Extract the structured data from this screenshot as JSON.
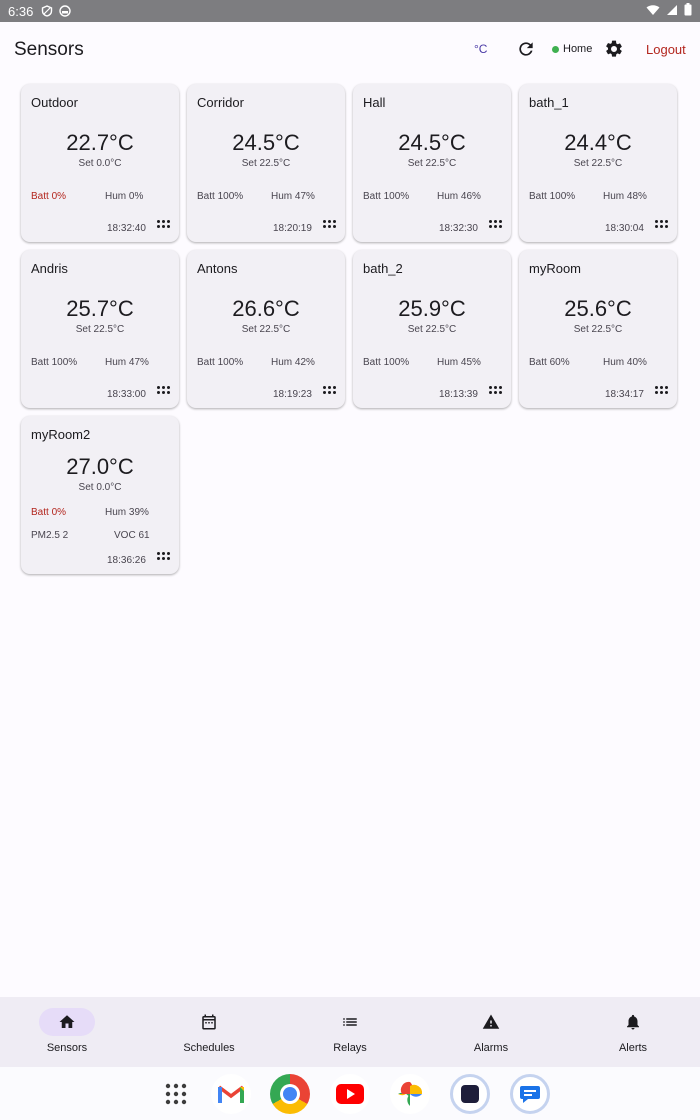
{
  "status_bar": {
    "time": "6:36"
  },
  "app_bar": {
    "title": "Sensors",
    "unit_label": "°C",
    "connection_label": "Home",
    "logout_label": "Logout"
  },
  "sensors": [
    {
      "name": "Outdoor",
      "temp": "22.7°C",
      "set": "Set 0.0°C",
      "batt": "Batt 0%",
      "hum": "Hum 0%",
      "time": "18:32:40"
    },
    {
      "name": "Corridor",
      "temp": "24.5°C",
      "set": "Set 22.5°C",
      "batt": "Batt 100%",
      "hum": "Hum 47%",
      "time": "18:20:19"
    },
    {
      "name": "Hall",
      "temp": "24.5°C",
      "set": "Set 22.5°C",
      "batt": "Batt 100%",
      "hum": "Hum 46%",
      "time": "18:32:30"
    },
    {
      "name": "bath_1",
      "temp": "24.4°C",
      "set": "Set 22.5°C",
      "batt": "Batt 100%",
      "hum": "Hum 48%",
      "time": "18:30:04"
    },
    {
      "name": "Andris",
      "temp": "25.7°C",
      "set": "Set 22.5°C",
      "batt": "Batt 100%",
      "hum": "Hum 47%",
      "time": "18:33:00"
    },
    {
      "name": "Antons",
      "temp": "26.6°C",
      "set": "Set 22.5°C",
      "batt": "Batt 100%",
      "hum": "Hum 42%",
      "time": "18:19:23"
    },
    {
      "name": "bath_2",
      "temp": "25.9°C",
      "set": "Set 22.5°C",
      "batt": "Batt 100%",
      "hum": "Hum 45%",
      "time": "18:13:39"
    },
    {
      "name": "myRoom",
      "temp": "25.6°C",
      "set": "Set 22.5°C",
      "batt": "Batt 60%",
      "hum": "Hum 40%",
      "time": "18:34:17"
    },
    {
      "name": "myRoom2",
      "temp": "27.0°C",
      "set": "Set 0.0°C",
      "batt": "Batt 0%",
      "hum": "Hum 39%",
      "pm": "PM2.5 2",
      "voc": "VOC 61",
      "time": "18:36:26"
    }
  ],
  "bottom_nav": [
    {
      "label": "Sensors",
      "icon": "home-icon"
    },
    {
      "label": "Schedules",
      "icon": "calendar-icon"
    },
    {
      "label": "Relays",
      "icon": "list-icon"
    },
    {
      "label": "Alarms",
      "icon": "warning-icon"
    },
    {
      "label": "Alerts",
      "icon": "bell-icon"
    }
  ],
  "dock": [
    "app-drawer-icon",
    "gmail-icon",
    "chrome-icon",
    "youtube-icon",
    "photos-icon",
    "app-icon",
    "messages-icon"
  ],
  "colors": {
    "accent": "#4a3aa6",
    "danger": "#b3261e",
    "online": "#3fb050",
    "card": "#f2f0f5",
    "nav_bg": "#efecf4"
  }
}
